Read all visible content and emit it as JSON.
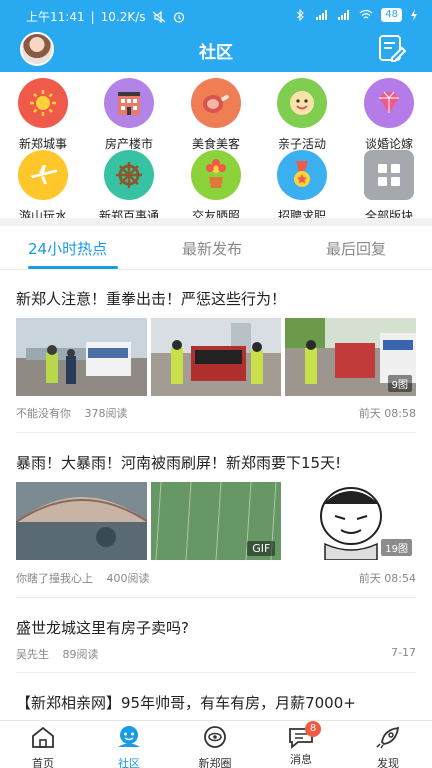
{
  "status": {
    "time": "上午11:41",
    "speed": "10.2K/s",
    "battery": "48"
  },
  "header": {
    "title": "社区"
  },
  "categories": [
    {
      "label": "新郑城事",
      "color": "#f05a4a",
      "icon": "sun-icon"
    },
    {
      "label": "房产楼市",
      "color": "#b483e8",
      "icon": "building-icon"
    },
    {
      "label": "美食美客",
      "color": "#f07e55",
      "icon": "ham-icon"
    },
    {
      "label": "亲子活动",
      "color": "#7fce4f",
      "icon": "baby-face-icon"
    },
    {
      "label": "谈婚论嫁",
      "color": "#b57be8",
      "icon": "diamond-icon"
    },
    {
      "label": "游山玩水",
      "color": "#ffc72a",
      "icon": "airplane-icon"
    },
    {
      "label": "新郑百事通",
      "color": "#37c3a3",
      "icon": "ship-wheel-icon"
    },
    {
      "label": "交友晒照",
      "color": "#8bd23b",
      "icon": "flower-pot-icon"
    },
    {
      "label": "招聘求职",
      "color": "#3ab0f0",
      "icon": "medal-icon"
    },
    {
      "label": "全部版块",
      "color": "#a5a9ad",
      "icon": "grid-icon"
    }
  ],
  "tabs": [
    "24小时热点",
    "最新发布",
    "最后回复"
  ],
  "posts": [
    {
      "title": "新郑人注意！重拳出击！严惩这些行为！",
      "author": "不能没有你",
      "reads": "378阅读",
      "time": "前天 08:58",
      "badge": "9图"
    },
    {
      "title": "暴雨！大暴雨！河南被雨刷屏！新郑雨要下15天!",
      "author": "你瞎了撞我心上",
      "reads": "400阅读",
      "time": "前天 08:54",
      "gif": "GIF",
      "badge": "19图"
    },
    {
      "title": "盛世龙城这里有房子卖吗?",
      "author": "吴先生",
      "reads": "89阅读",
      "time": "7-17"
    },
    {
      "title": "【新郑相亲网】95年帅哥，有车有房，月薪7000+"
    }
  ],
  "nav": [
    {
      "label": "首页",
      "icon": "home-icon"
    },
    {
      "label": "社区",
      "icon": "community-icon"
    },
    {
      "label": "新郑圈",
      "icon": "circle-icon"
    },
    {
      "label": "消息",
      "icon": "message-icon",
      "badge": "8"
    },
    {
      "label": "发现",
      "icon": "rocket-icon"
    }
  ],
  "colors": {
    "brand": "#29a9f0",
    "accent": "#1a9be6",
    "badge": "#f25a3e"
  }
}
